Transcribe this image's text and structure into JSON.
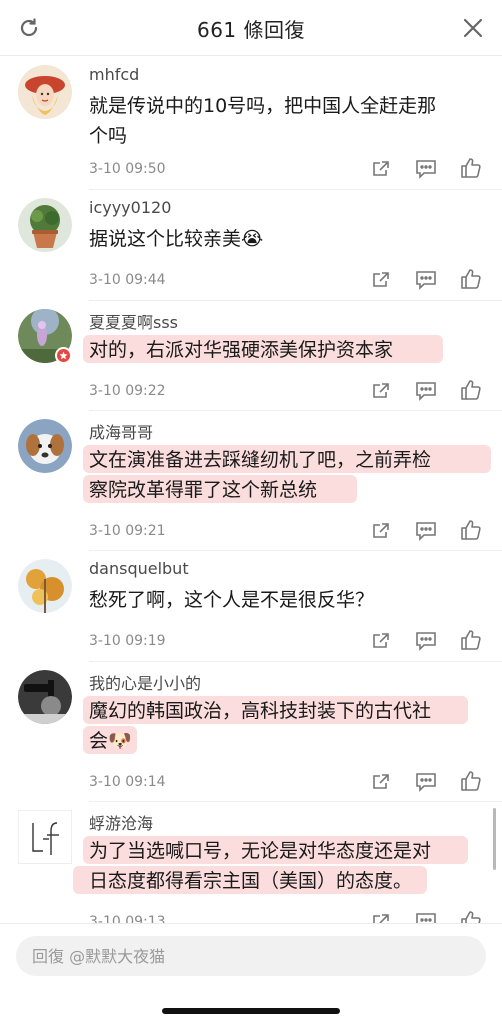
{
  "header": {
    "title": "661 條回復",
    "refresh_icon": "refresh-icon",
    "close_icon": "close-icon"
  },
  "comments": [
    {
      "username": "mhfcd",
      "text": [
        "就是传说中的10号吗，把中国人全赶走那",
        "个吗"
      ],
      "time": "3-10 09:50",
      "highlighted": false
    },
    {
      "username": "icyyy0120",
      "text": [
        "据说这个比较亲美😭"
      ],
      "time": "3-10 09:44",
      "highlighted": false
    },
    {
      "username": "夏夏夏啊sss",
      "text": [
        "对的，右派对华强硬添美保护资本家"
      ],
      "time": "3-10 09:22",
      "highlighted": true
    },
    {
      "username": "成海哥哥",
      "text": [
        "文在演准备进去踩缝纫机了吧，之前弄检",
        "察院改革得罪了这个新总统"
      ],
      "time": "3-10 09:21",
      "highlighted": true
    },
    {
      "username": "dansquelbut",
      "text": [
        "愁死了啊，这个人是不是很反华？"
      ],
      "time": "3-10 09:19",
      "highlighted": false
    },
    {
      "username": "我的心是小小的",
      "text": [
        "魔幻的韩国政治，高科技封装下的古代社",
        "会🐶"
      ],
      "time": "3-10 09:14",
      "highlighted": true
    },
    {
      "username": "蜉游沧海",
      "text": [
        "为了当选喊口号，无论是对华态度还是对",
        "日态度都得看宗主国（美国）的态度。"
      ],
      "time": "3-10 09:13",
      "highlighted": true
    }
  ],
  "actions": {
    "repost_icon": "repost-icon",
    "comment_icon": "comment-icon",
    "like_icon": "like-icon"
  },
  "reply": {
    "placeholder": "回復 @默默大夜猫"
  },
  "colors": {
    "highlight": "#f39696",
    "badge": "#e8453c"
  }
}
